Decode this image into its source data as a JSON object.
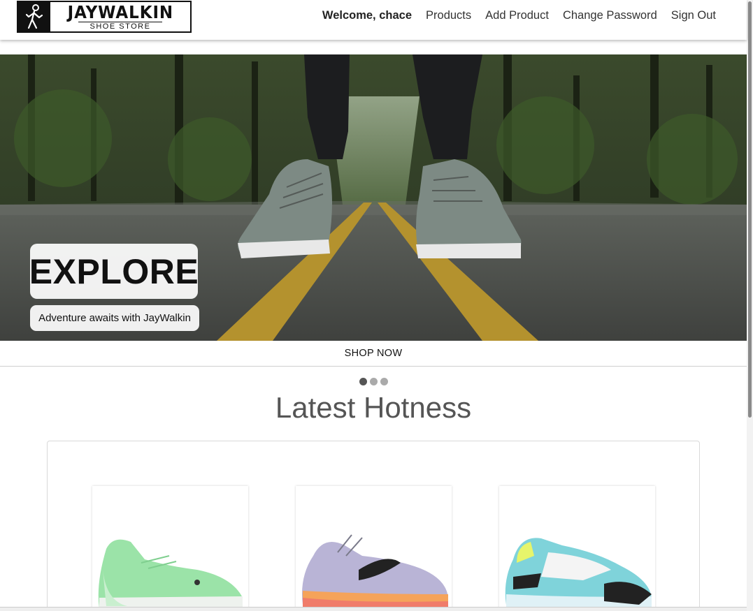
{
  "logo": {
    "title": "JAYWALKIN",
    "subtitle": "SHOE STORE",
    "icon": "walking-person-icon"
  },
  "nav": {
    "welcome": "Welcome, chace",
    "items": [
      {
        "label": "Products"
      },
      {
        "label": "Add Product"
      },
      {
        "label": "Change Password"
      },
      {
        "label": "Sign Out"
      }
    ]
  },
  "hero": {
    "heading": "EXPLORE",
    "tagline": "Adventure awaits with JayWalkin",
    "cta": "SHOP NOW",
    "slide_count": 3,
    "active_slide": 1
  },
  "section": {
    "title": "Latest Hotness"
  },
  "products": [
    {
      "image": "green-sneaker-image",
      "color": "#9be3a8"
    },
    {
      "image": "lavender-sneaker-image",
      "color": "#b9b4d6"
    },
    {
      "image": "aqua-sneaker-image",
      "color": "#7fd3da"
    }
  ],
  "colors": {
    "road": "#4b4d4a",
    "road_line": "#b4922e",
    "trees": "#2f3b22"
  }
}
